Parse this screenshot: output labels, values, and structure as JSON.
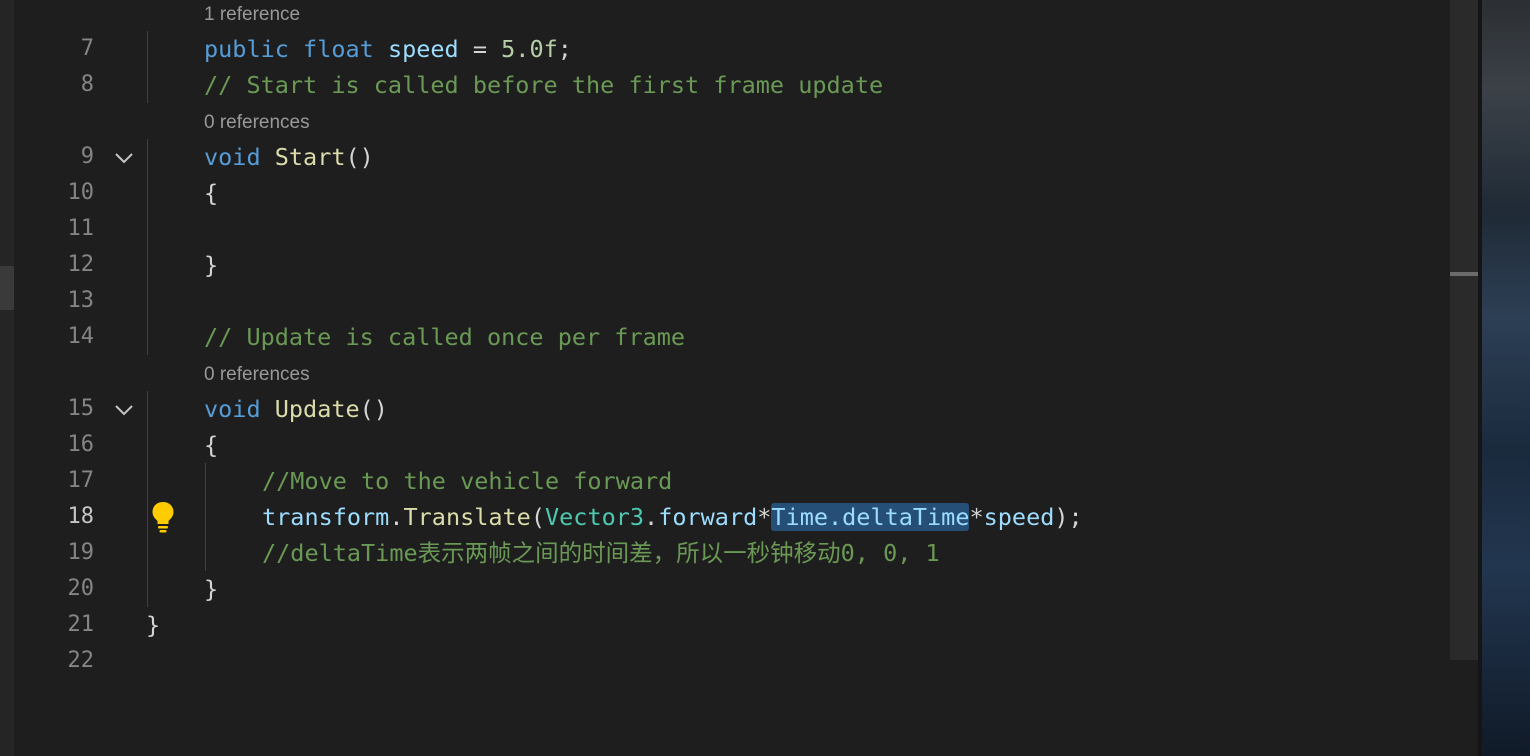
{
  "editor": {
    "references": {
      "speed": "1 reference",
      "start": "0 references",
      "update": "0 references"
    },
    "line_numbers": [
      "7",
      "8",
      "9",
      "10",
      "11",
      "12",
      "13",
      "14",
      "15",
      "16",
      "17",
      "18",
      "19",
      "20",
      "21",
      "22"
    ],
    "active_line": "18",
    "lines": {
      "l7": {
        "kw1": "public",
        "kw2": "float",
        "var": "speed",
        "op": " = ",
        "num": "5.0f",
        "end": ";"
      },
      "l8": {
        "comment": "// Start is called before the first frame update"
      },
      "l9": {
        "kw": "void",
        "fn": "Start",
        "parens": "()"
      },
      "l10": {
        "text": "{"
      },
      "l12": {
        "text": "}"
      },
      "l14": {
        "comment": "// Update is called once per frame"
      },
      "l15": {
        "kw": "void",
        "fn": "Update",
        "parens": "()"
      },
      "l16": {
        "text": "{"
      },
      "l17": {
        "comment": "//Move to the vehicle forward"
      },
      "l18": {
        "var1": "transform",
        "dot1": ".",
        "fn": "Translate",
        "open": "(",
        "type1": "Vector3",
        "dot2": ".",
        "var2": "forward",
        "star1": "*",
        "sel": "Time.deltaTime",
        "star2": "*",
        "var3": "speed",
        "close": ");"
      },
      "l19": {
        "comment": "//deltaTime表示两帧之间的时间差，所以一秒钟移动0, 0, 1"
      },
      "l20": {
        "text": "}"
      },
      "l21": {
        "text": "}"
      }
    },
    "icons": {
      "fold": "chevron-down-icon",
      "lightbulb": "lightbulb-icon"
    },
    "colors": {
      "background": "#1e1e1e",
      "keyword": "#569cd6",
      "variable": "#9cdcfe",
      "function": "#dcdcaa",
      "type": "#4ec9b0",
      "comment": "#6a9955",
      "number": "#b5cea8",
      "selection": "#264f78",
      "lightbulb": "#ffcc00"
    }
  }
}
